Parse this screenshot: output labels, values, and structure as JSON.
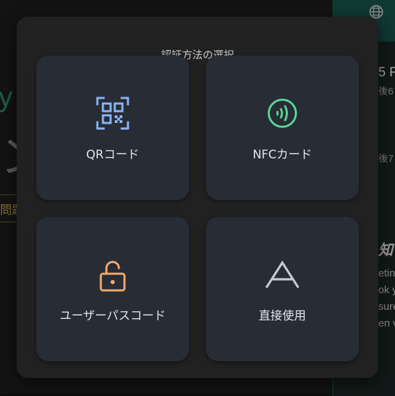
{
  "modal": {
    "title": "認証方法の選択"
  },
  "options": [
    {
      "label": "QRコード",
      "icon": "qr-code-icon",
      "color": "#8ab4f8"
    },
    {
      "label": "NFCカード",
      "icon": "nfc-icon",
      "color": "#5bd598"
    },
    {
      "label": "ユーザーパスコード",
      "icon": "unlock-icon",
      "color": "#f5a96b"
    },
    {
      "label": "直接使用",
      "icon": "direct-use-icon",
      "color": "#c9cad1"
    }
  ],
  "background": {
    "globe_icon": "globe-icon",
    "right_fragments": [
      "5 F",
      "後6",
      "後7",
      "知",
      "etin",
      "ok y",
      "sure",
      "en v"
    ],
    "left_fragments": [
      "y",
      "ン",
      "問題"
    ]
  }
}
